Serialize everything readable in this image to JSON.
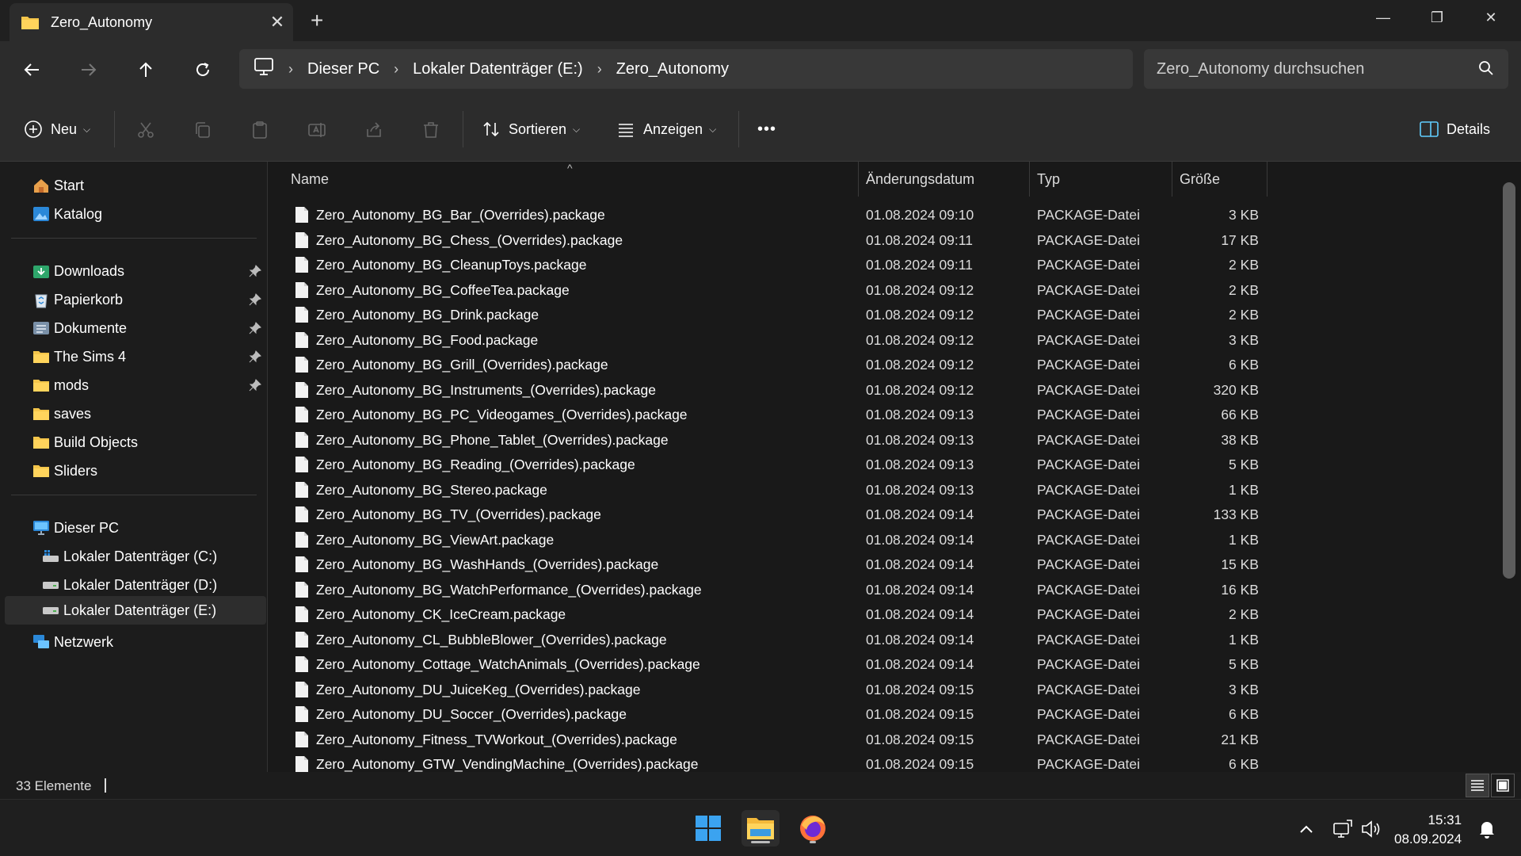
{
  "tab": {
    "title": "Zero_Autonomy",
    "close_glyph": "✕",
    "new_glyph": "+"
  },
  "window": {
    "minimize": "—",
    "restore": "❐",
    "close": "✕"
  },
  "breadcrumb": [
    {
      "label": "Dieser PC"
    },
    {
      "label": "Lokaler Datenträger (E:)"
    },
    {
      "label": "Zero_Autonomy"
    }
  ],
  "search": {
    "placeholder": "Zero_Autonomy durchsuchen"
  },
  "toolbar": {
    "new_label": "Neu",
    "sort_label": "Sortieren",
    "view_label": "Anzeigen",
    "more_label": "•••",
    "details_label": "Details"
  },
  "sidebar": {
    "quick": [
      {
        "label": "Start",
        "icon": "home-icon"
      },
      {
        "label": "Katalog",
        "icon": "gallery-icon"
      }
    ],
    "pinned": [
      {
        "label": "Downloads",
        "icon": "downloads-icon",
        "pinned": true
      },
      {
        "label": "Papierkorb",
        "icon": "recycle-bin-icon",
        "pinned": true
      },
      {
        "label": "Dokumente",
        "icon": "documents-icon",
        "pinned": true
      },
      {
        "label": "The Sims 4",
        "icon": "folder-icon",
        "pinned": true
      },
      {
        "label": "mods",
        "icon": "folder-icon",
        "pinned": true
      },
      {
        "label": "saves",
        "icon": "folder-icon",
        "pinned": false
      },
      {
        "label": "Build Objects",
        "icon": "folder-icon",
        "pinned": false
      },
      {
        "label": "Sliders",
        "icon": "folder-icon",
        "pinned": false
      }
    ],
    "pc_label": "Dieser PC",
    "drives": [
      {
        "label": "Lokaler Datenträger (C:)"
      },
      {
        "label": "Lokaler Datenträger (D:)"
      },
      {
        "label": "Lokaler Datenträger (E:)",
        "selected": true
      }
    ],
    "network_label": "Netzwerk"
  },
  "columns": {
    "name": "Name",
    "date": "Änderungsdatum",
    "type": "Typ",
    "size": "Größe"
  },
  "files": [
    {
      "name": "Zero_Autonomy_BG_Bar_(Overrides).package",
      "date": "01.08.2024 09:10",
      "type": "PACKAGE-Datei",
      "size": "3 KB"
    },
    {
      "name": "Zero_Autonomy_BG_Chess_(Overrides).package",
      "date": "01.08.2024 09:11",
      "type": "PACKAGE-Datei",
      "size": "17 KB"
    },
    {
      "name": "Zero_Autonomy_BG_CleanupToys.package",
      "date": "01.08.2024 09:11",
      "type": "PACKAGE-Datei",
      "size": "2 KB"
    },
    {
      "name": "Zero_Autonomy_BG_CoffeeTea.package",
      "date": "01.08.2024 09:12",
      "type": "PACKAGE-Datei",
      "size": "2 KB"
    },
    {
      "name": "Zero_Autonomy_BG_Drink.package",
      "date": "01.08.2024 09:12",
      "type": "PACKAGE-Datei",
      "size": "2 KB"
    },
    {
      "name": "Zero_Autonomy_BG_Food.package",
      "date": "01.08.2024 09:12",
      "type": "PACKAGE-Datei",
      "size": "3 KB"
    },
    {
      "name": "Zero_Autonomy_BG_Grill_(Overrides).package",
      "date": "01.08.2024 09:12",
      "type": "PACKAGE-Datei",
      "size": "6 KB"
    },
    {
      "name": "Zero_Autonomy_BG_Instruments_(Overrides).package",
      "date": "01.08.2024 09:12",
      "type": "PACKAGE-Datei",
      "size": "320 KB"
    },
    {
      "name": "Zero_Autonomy_BG_PC_Videogames_(Overrides).package",
      "date": "01.08.2024 09:13",
      "type": "PACKAGE-Datei",
      "size": "66 KB"
    },
    {
      "name": "Zero_Autonomy_BG_Phone_Tablet_(Overrides).package",
      "date": "01.08.2024 09:13",
      "type": "PACKAGE-Datei",
      "size": "38 KB"
    },
    {
      "name": "Zero_Autonomy_BG_Reading_(Overrides).package",
      "date": "01.08.2024 09:13",
      "type": "PACKAGE-Datei",
      "size": "5 KB"
    },
    {
      "name": "Zero_Autonomy_BG_Stereo.package",
      "date": "01.08.2024 09:13",
      "type": "PACKAGE-Datei",
      "size": "1 KB"
    },
    {
      "name": "Zero_Autonomy_BG_TV_(Overrides).package",
      "date": "01.08.2024 09:14",
      "type": "PACKAGE-Datei",
      "size": "133 KB"
    },
    {
      "name": "Zero_Autonomy_BG_ViewArt.package",
      "date": "01.08.2024 09:14",
      "type": "PACKAGE-Datei",
      "size": "1 KB"
    },
    {
      "name": "Zero_Autonomy_BG_WashHands_(Overrides).package",
      "date": "01.08.2024 09:14",
      "type": "PACKAGE-Datei",
      "size": "15 KB"
    },
    {
      "name": "Zero_Autonomy_BG_WatchPerformance_(Overrides).package",
      "date": "01.08.2024 09:14",
      "type": "PACKAGE-Datei",
      "size": "16 KB"
    },
    {
      "name": "Zero_Autonomy_CK_IceCream.package",
      "date": "01.08.2024 09:14",
      "type": "PACKAGE-Datei",
      "size": "2 KB"
    },
    {
      "name": "Zero_Autonomy_CL_BubbleBlower_(Overrides).package",
      "date": "01.08.2024 09:14",
      "type": "PACKAGE-Datei",
      "size": "1 KB"
    },
    {
      "name": "Zero_Autonomy_Cottage_WatchAnimals_(Overrides).package",
      "date": "01.08.2024 09:14",
      "type": "PACKAGE-Datei",
      "size": "5 KB"
    },
    {
      "name": "Zero_Autonomy_DU_JuiceKeg_(Overrides).package",
      "date": "01.08.2024 09:15",
      "type": "PACKAGE-Datei",
      "size": "3 KB"
    },
    {
      "name": "Zero_Autonomy_DU_Soccer_(Overrides).package",
      "date": "01.08.2024 09:15",
      "type": "PACKAGE-Datei",
      "size": "6 KB"
    },
    {
      "name": "Zero_Autonomy_Fitness_TVWorkout_(Overrides).package",
      "date": "01.08.2024 09:15",
      "type": "PACKAGE-Datei",
      "size": "21 KB"
    },
    {
      "name": "Zero_Autonomy_GTW_VendingMachine_(Overrides).package",
      "date": "01.08.2024 09:15",
      "type": "PACKAGE-Datei",
      "size": "6 KB"
    }
  ],
  "status": {
    "count": "33 Elemente"
  },
  "taskbar": {
    "time": "15:31",
    "date": "08.09.2024"
  },
  "colors": {
    "accent": "#60cdff",
    "folder": "#f4c54a",
    "background": "#191919"
  }
}
